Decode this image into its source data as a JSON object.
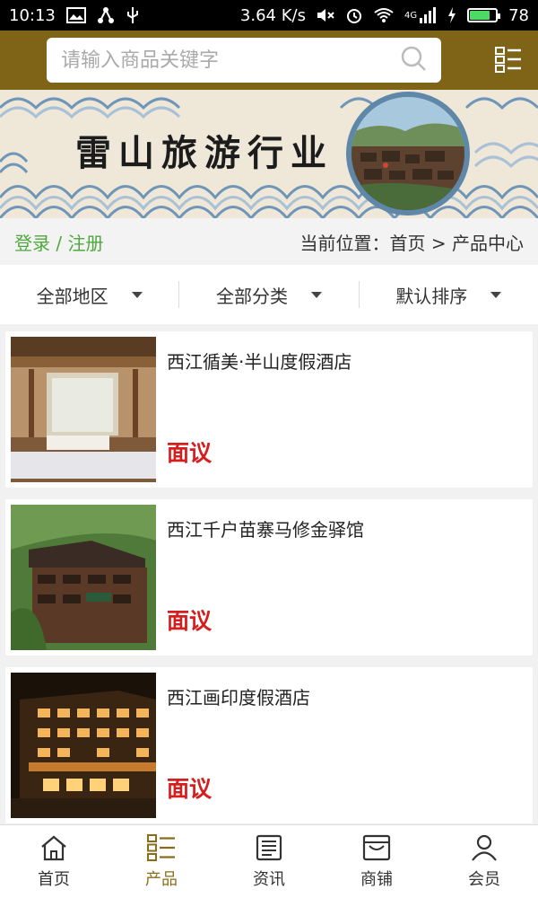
{
  "status_bar": {
    "time": "10:13",
    "speed": "3.64 K/s",
    "network": "4G",
    "battery": "78",
    "battery_level": 0.78
  },
  "search": {
    "placeholder": "请输入商品关键字"
  },
  "banner": {
    "title": "雷山旅游行业"
  },
  "auth": {
    "login": "登录",
    "separator": " / ",
    "register": "注册"
  },
  "breadcrumb": {
    "prefix": "当前位置：",
    "home": "首页",
    "sep": " > ",
    "current": "产品中心"
  },
  "filters": [
    {
      "label": "全部地区"
    },
    {
      "label": "全部分类"
    },
    {
      "label": "默认排序"
    }
  ],
  "products": [
    {
      "name": "西江循美·半山度假酒店",
      "price": "面议"
    },
    {
      "name": "西江千户苗寨马修金驿馆",
      "price": "面议"
    },
    {
      "name": "西江画印度假酒店",
      "price": "面议"
    }
  ],
  "nav": [
    {
      "label": "首页",
      "icon": "home-icon"
    },
    {
      "label": "产品",
      "icon": "list-icon"
    },
    {
      "label": "资讯",
      "icon": "news-icon"
    },
    {
      "label": "商铺",
      "icon": "store-icon"
    },
    {
      "label": "会员",
      "icon": "user-icon"
    }
  ],
  "colors": {
    "header_bg": "#7f6418",
    "accent": "#8a6d1a",
    "price": "#d71d1d",
    "login": "#4fa83d"
  }
}
